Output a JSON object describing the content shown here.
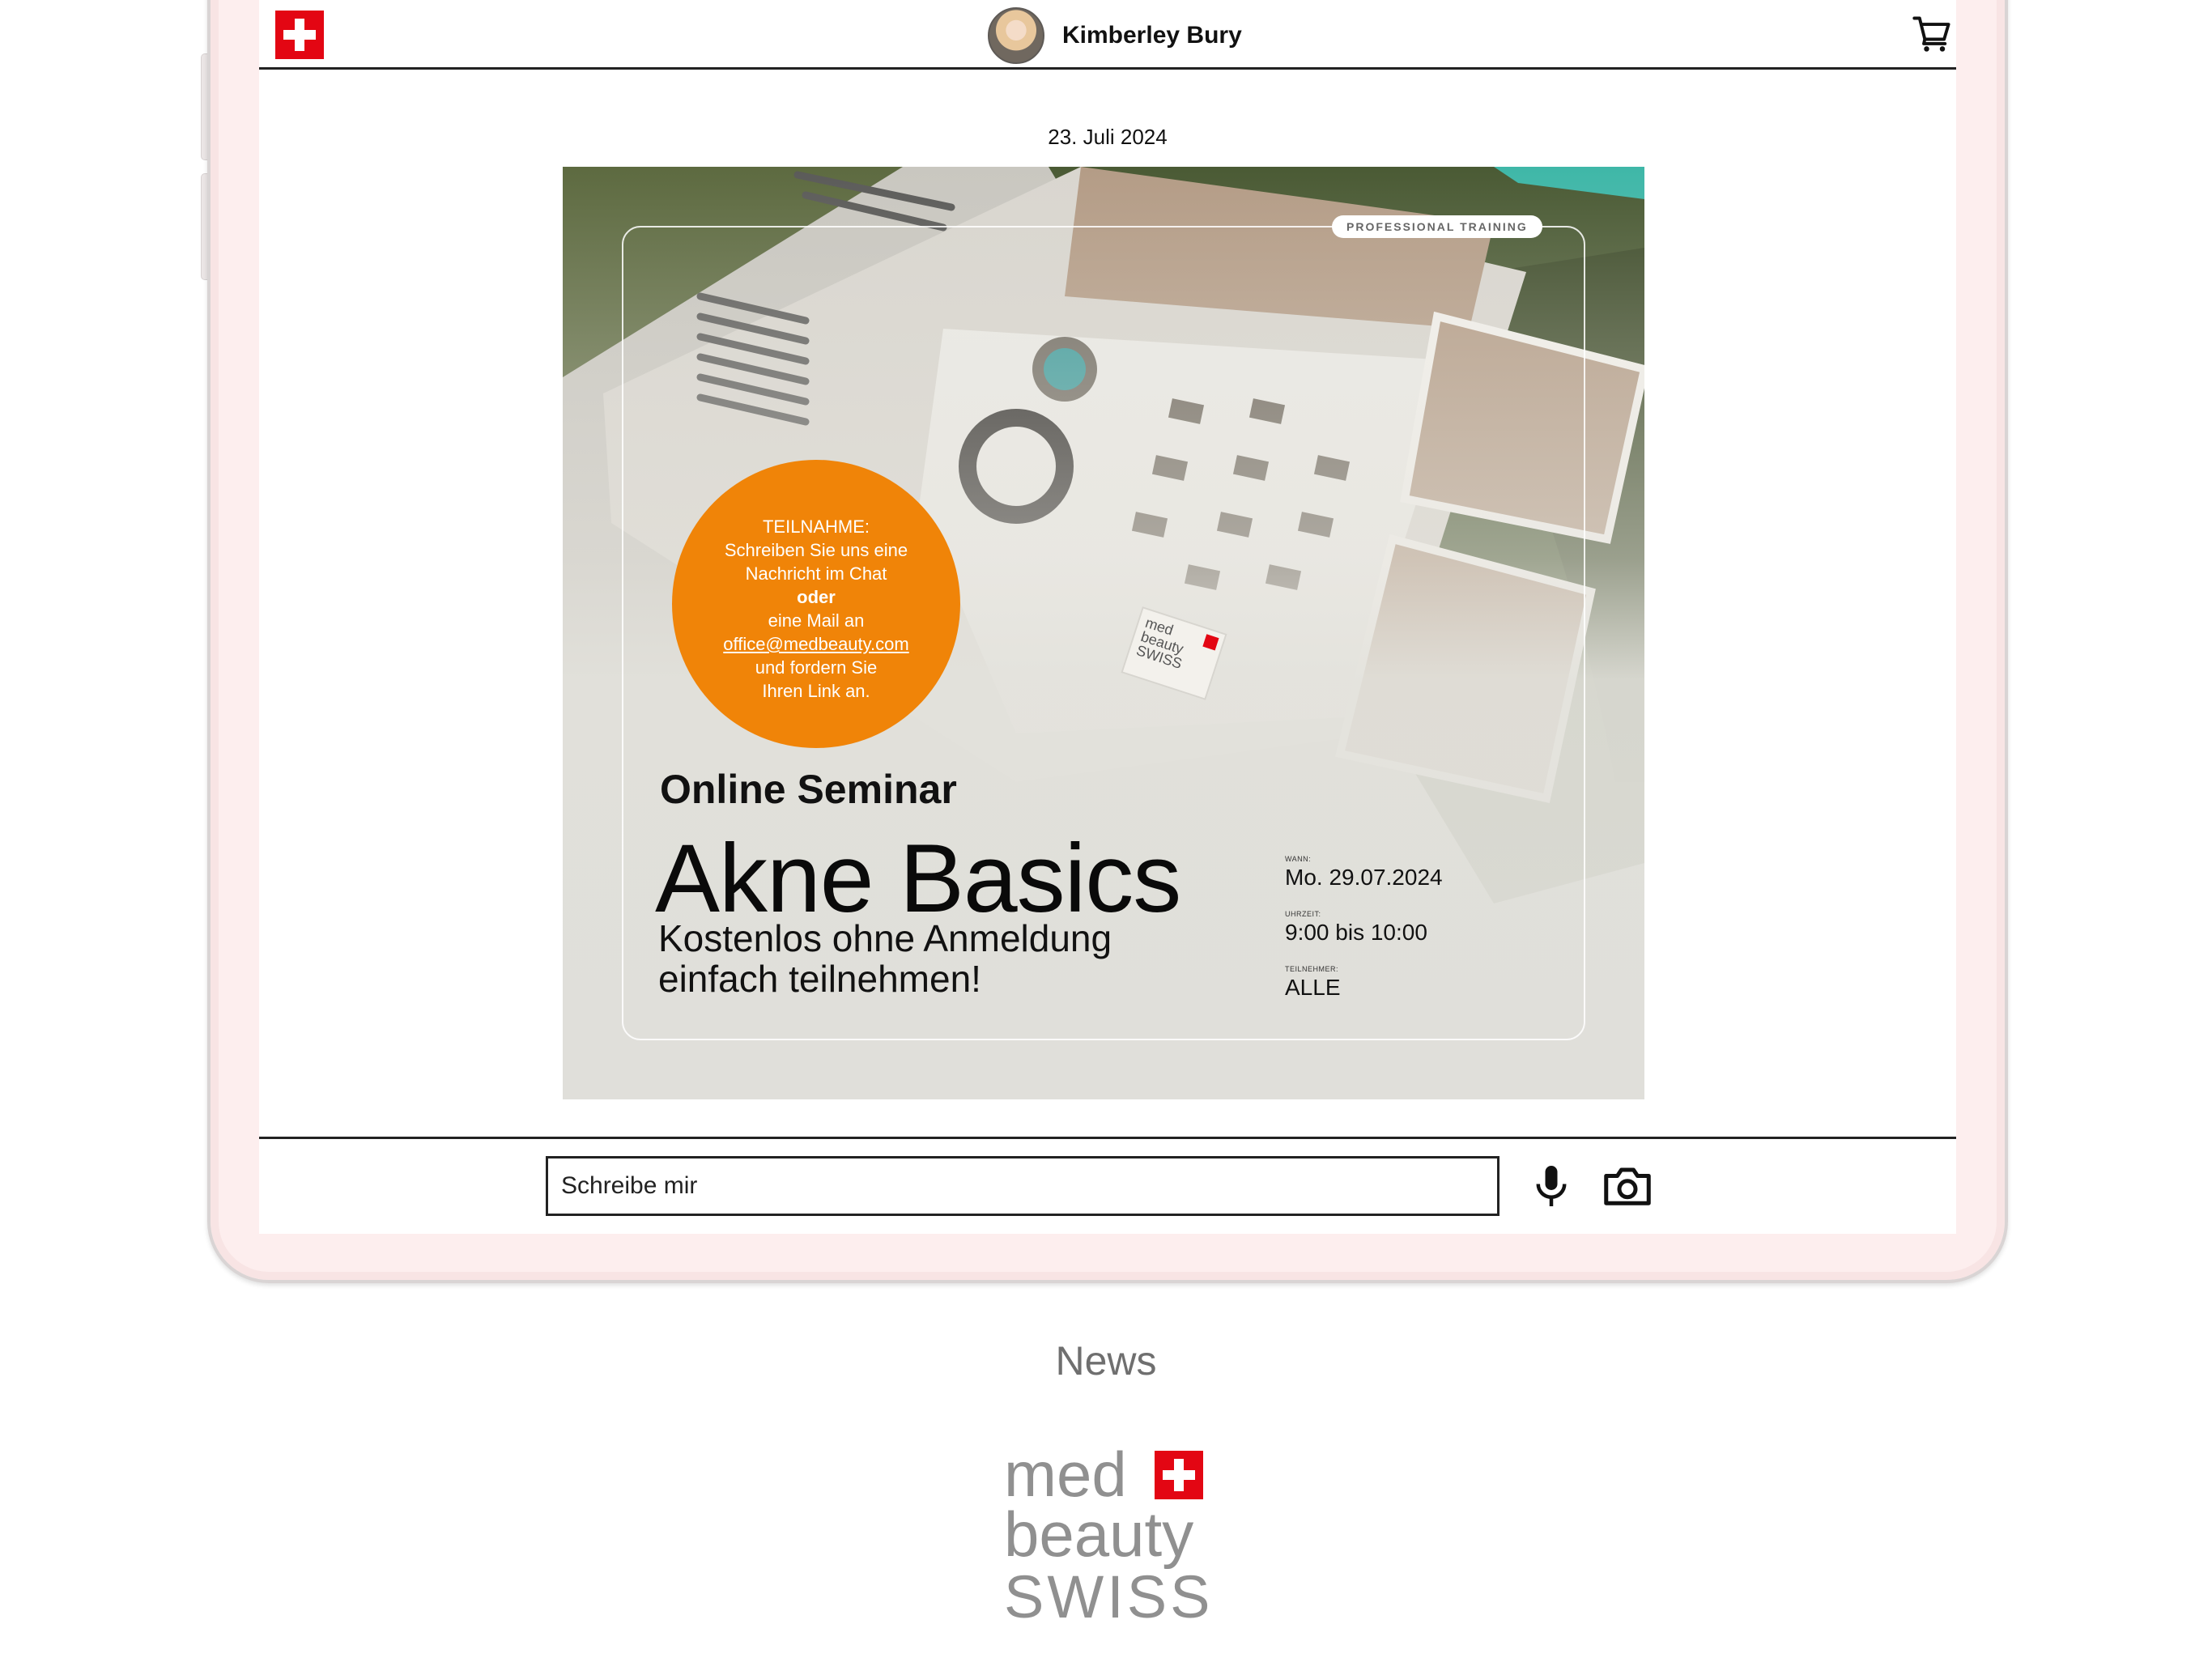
{
  "header": {
    "contact_name": "Kimberley Bury"
  },
  "chat": {
    "date": "23. Juli 2024",
    "flyer": {
      "badge": "PROFESSIONAL TRAINING",
      "bubble": {
        "line1": "TEILNAHME:",
        "line2": "Schreiben Sie uns eine",
        "line3": "Nachricht im Chat",
        "line4": "oder",
        "line5": "eine Mail an",
        "email": "office@medbeauty.com",
        "line6": "und fordern Sie",
        "line7": "Ihren Link an."
      },
      "kicker": "Online Seminar",
      "title": "Akne Basics",
      "subtitle_line1": "Kostenlos ohne Anmeldung",
      "subtitle_line2": "einfach teilnehmen!",
      "when_label": "WANN:",
      "when_value": "Mo. 29.07.2024",
      "time_label": "UHRZEIT:",
      "time_value": "9:00 bis 10:00",
      "attendees_label": "TEILNEHMER:",
      "attendees_value": "ALLE",
      "sign": {
        "med": "med",
        "beauty": "beauty",
        "swiss": "SWISS"
      }
    }
  },
  "composer": {
    "placeholder": "Schreibe mir"
  },
  "page": {
    "section_title": "News",
    "logo": {
      "med": "med",
      "beauty": "beauty",
      "swiss": "SWISS"
    }
  },
  "colors": {
    "brand_red": "#e30613",
    "bubble_orange": "#f08408",
    "device_frame": "#fdeeee",
    "muted_text": "#6f6f6f"
  },
  "icons": {
    "app_logo": "swiss-cross-icon",
    "cart": "cart-icon",
    "mic": "microphone-icon",
    "camera": "camera-icon"
  }
}
